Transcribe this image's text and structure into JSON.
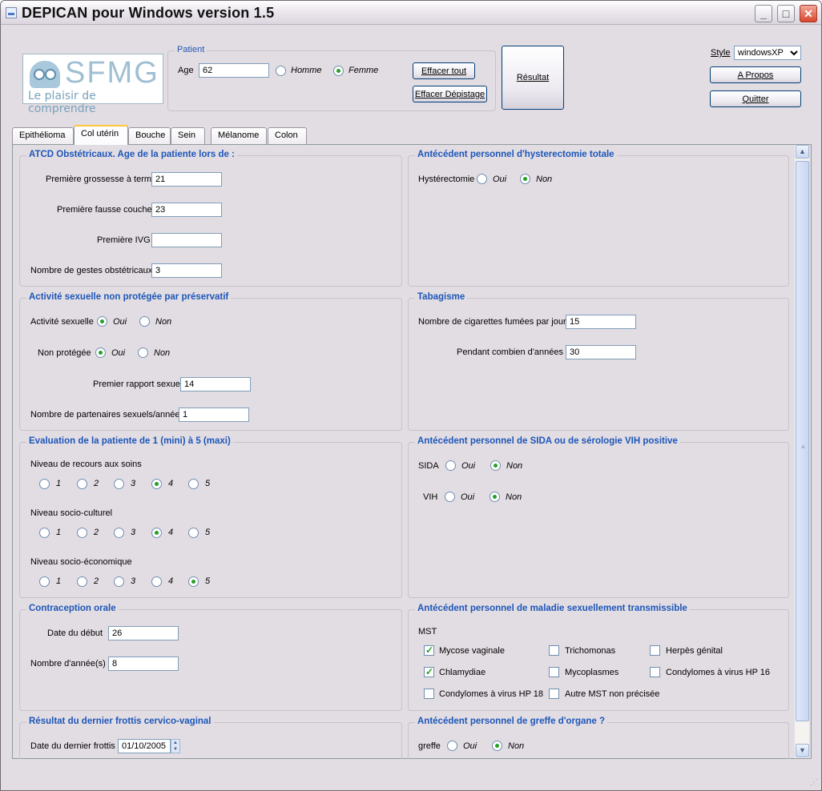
{
  "window": {
    "title": "DEPICAN pour Windows version 1.5"
  },
  "logo": {
    "brand": "SFMG",
    "tagline": "Le plaisir de comprendre"
  },
  "patient": {
    "group_title": "Patient",
    "age_label": "Age",
    "age_value": "62",
    "sex_options": [
      "Homme",
      "Femme"
    ],
    "sex_selected": "Femme",
    "effacer_tout": "Effacer tout",
    "effacer_depistage": "Effacer Dépistage"
  },
  "resultat_button": "Résultat",
  "style": {
    "label": "Style",
    "value": "windowsXP",
    "apropos": "A Propos",
    "quitter": "Quitter"
  },
  "tabs": [
    "Epithélioma",
    "Col utérin",
    "Bouche",
    "Sein",
    "Mélanome",
    "Colon"
  ],
  "active_tab": "Col utérin",
  "atcd": {
    "title": "ATCD Obstétricaux.  Age de la patiente lors de :",
    "grossesse_label": "Première grossesse à terme",
    "grossesse_value": "21",
    "fausse_couche_label": "Première fausse couche",
    "fausse_couche_value": "23",
    "ivg_label": "Première IVG",
    "ivg_value": "",
    "gestes_label": "Nombre de gestes obstétricaux",
    "gestes_value": "3"
  },
  "hysterectomie": {
    "title": "Antécédent personnel d'hysterectomie totale",
    "label": "Hystérectomie",
    "oui": "Oui",
    "non": "Non",
    "selected": "Non"
  },
  "activite": {
    "title": "Activité sexuelle non protégée par préservatif",
    "activite_label": "Activité sexuelle",
    "activite_selected": "Oui",
    "non_protegee_label": "Non protégée",
    "non_protegee_selected": "Oui",
    "oui": "Oui",
    "non": "Non",
    "premier_rapport_label": "Premier rapport sexuel",
    "premier_rapport_value": "14",
    "partenaires_label": "Nombre de partenaires sexuels/année",
    "partenaires_value": "1"
  },
  "tabagisme": {
    "title": "Tabagisme",
    "cigarettes_label": "Nombre de cigarettes fumées par jour",
    "cigarettes_value": "15",
    "annees_label": "Pendant combien d'années",
    "annees_value": "30"
  },
  "evaluation": {
    "title": "Evaluation de la patiente de 1 (mini) à 5 (maxi)",
    "levels": [
      "1",
      "2",
      "3",
      "4",
      "5"
    ],
    "recours_label": "Niveau de recours aux soins",
    "recours_selected": 4,
    "socio_culturel_label": "Niveau socio-culturel",
    "socio_culturel_selected": 4,
    "socio_economique_label": "Niveau socio-économique",
    "socio_economique_selected": 5
  },
  "sida": {
    "title": "Antécédent personnel de SIDA ou de sérologie VIH positive",
    "sida_label": "SIDA",
    "sida_selected": "Non",
    "vih_label": "VIH",
    "vih_selected": "Non",
    "oui": "Oui",
    "non": "Non"
  },
  "contraception": {
    "title": "Contraception orale",
    "debut_label": "Date du début",
    "debut_value": "26",
    "annees_label": "Nombre d'année(s)",
    "annees_value": "8"
  },
  "mst": {
    "title": "Antécédent personnel de maladie sexuellement transmissible",
    "label": "MST",
    "items": [
      {
        "label": "Mycose vaginale",
        "checked": true
      },
      {
        "label": "Trichomonas",
        "checked": false
      },
      {
        "label": "Herpès génital",
        "checked": false
      },
      {
        "label": "Chlamydiae",
        "checked": true
      },
      {
        "label": "Mycoplasmes",
        "checked": false
      },
      {
        "label": "Condylomes à virus HP 16",
        "checked": false
      },
      {
        "label": "Condylomes à virus HP 18",
        "checked": false
      },
      {
        "label": "Autre MST non précisée",
        "checked": false
      }
    ]
  },
  "frottis": {
    "title": "Résultat du dernier frottis cervico-vaginal",
    "date_label": "Date du dernier frottis",
    "date_value": "01/10/2005"
  },
  "greffe": {
    "title": "Antécédent personnel de greffe d'organe ?",
    "label": "greffe",
    "oui": "Oui",
    "non": "Non",
    "selected": "Non"
  }
}
